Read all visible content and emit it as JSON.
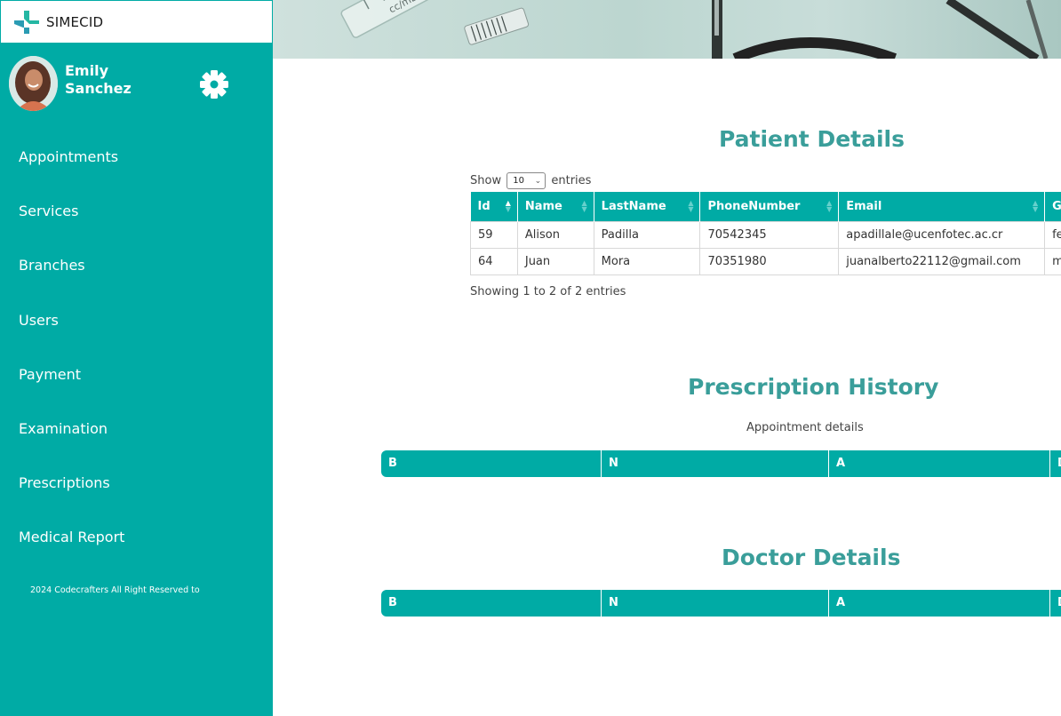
{
  "brand": {
    "name": "SIMECID"
  },
  "user": {
    "name": "Emily Sanchez"
  },
  "nav": [
    "Appointments",
    "Services",
    "Branches",
    "Users",
    "Payment",
    "Examination",
    "Prescriptions",
    "Medical Report"
  ],
  "footer": "2024 Codecrafters All Right Reserved to",
  "patient": {
    "title": "Patient Details",
    "show_label": "Show",
    "page_length": "10",
    "entries_label": "entries",
    "columns": [
      "Id",
      "Name",
      "LastName",
      "PhoneNumber",
      "Email",
      "G"
    ],
    "rows": [
      [
        "59",
        "Alison",
        "Padilla",
        "70542345",
        "apadillale@ucenfotec.ac.cr",
        "fe"
      ],
      [
        "64",
        "Juan",
        "Mora",
        "70351980",
        "juanalberto22112@gmail.com",
        "m"
      ]
    ],
    "info": "Showing 1 to 2 of 2 entries"
  },
  "prescription": {
    "title": "Prescription History",
    "subtitle": "Appointment details",
    "columns": [
      "B",
      "N",
      "A",
      "D"
    ]
  },
  "doctor": {
    "title": "Doctor Details",
    "columns": [
      "B",
      "N",
      "A",
      "D"
    ]
  },
  "colors": {
    "sidebar": "#00aba5",
    "table_header": "#00aba5",
    "title": "#3a9e9a"
  }
}
